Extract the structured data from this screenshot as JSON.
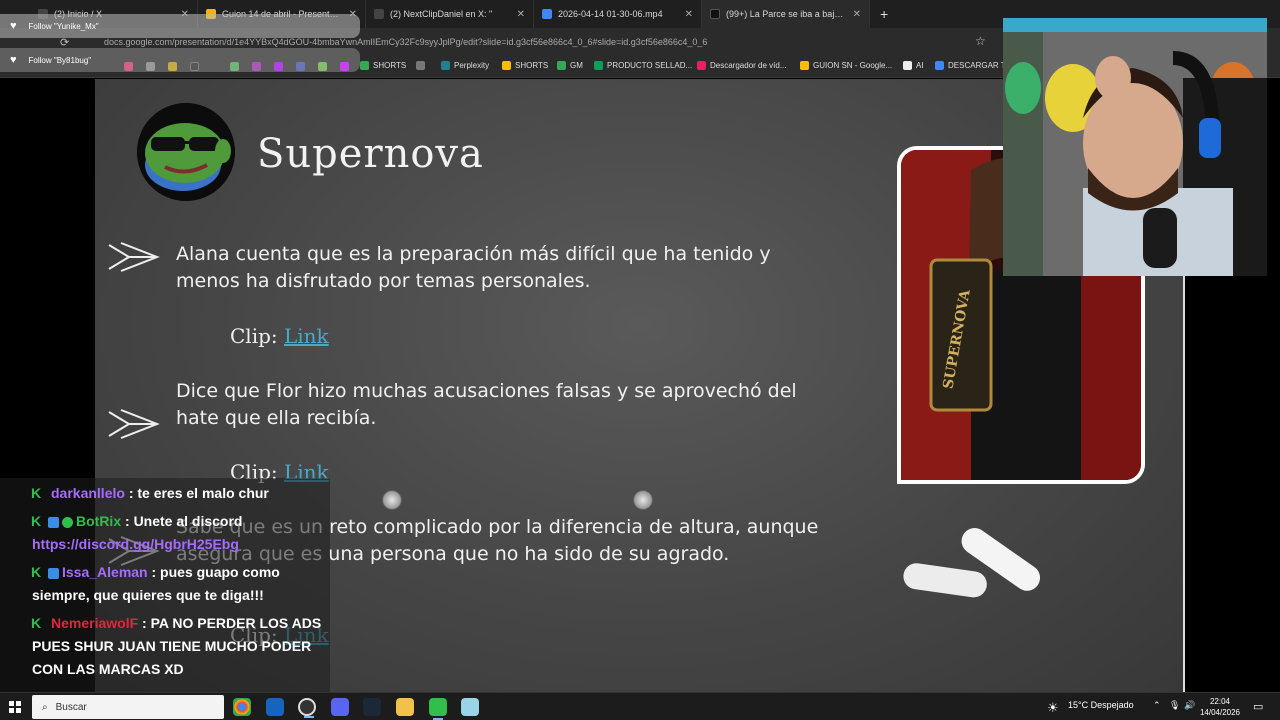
{
  "browser": {
    "tabs": [
      {
        "label": "(2) Inicio / X",
        "color": "#444444"
      },
      {
        "label": "Guion 14 de abril - Presentació",
        "color": "#f4b400"
      },
      {
        "label": "(2) NextClipDaniel en X: \"",
        "color": "#444444"
      },
      {
        "label": "2026-04-14 01-30-06.mp4",
        "color": "#4285f4"
      },
      {
        "label": "(99+) La Parce se iba a bajar de",
        "color": "#111111"
      }
    ],
    "new_tab_label": "+",
    "url": "docs.google.com/presentation/d/1e4YYBxQ4dGOU-4bmbaYwnAmlIEmCy32Fc9syyJplPg/edit?slide=id.g3cf56e866c4_0_6#slide=id.g3cf56e866c4_0_6",
    "bookmarks": [
      {
        "label": "SHORTS",
        "color": "#34a853"
      },
      {
        "label": "Perplexity",
        "color": "#20808d"
      },
      {
        "label": "SHORTS",
        "color": "#fbbc04"
      },
      {
        "label": "GM",
        "color": "#34a853"
      },
      {
        "label": "PRODUCTO SELLAD...",
        "color": "#0f9d58"
      },
      {
        "label": "Descargador de víd...",
        "color": "#e91e63"
      },
      {
        "label": "GUION SN - Google...",
        "color": "#fbbc04"
      },
      {
        "label": "AI",
        "color": "#eeeeee"
      },
      {
        "label": "DESCARGAR TV",
        "color": "#4285f4"
      }
    ]
  },
  "follows": [
    {
      "text": "Follow \"Yunike_Mx\""
    },
    {
      "text": "Follow \"By81bug\""
    }
  ],
  "slide": {
    "title": "Supernova",
    "bullets": [
      {
        "text": "Alana cuenta que es la preparación más difícil que ha tenido y menos ha disfrutado por temas personales."
      },
      {
        "text": "Dice que Flor hizo muchas acusaciones falsas y se aprovechó del hate que ella recibía."
      },
      {
        "text": "Sabe que es un reto complicado por la diferencia de altura, aunque asegura que es una persona que no ha sido de su agrado."
      }
    ],
    "clip_label": "Clip:",
    "link_label": "Link",
    "photo_text": "SUPERNOVA"
  },
  "chat": [
    {
      "user": "darkanllelo",
      "user_color": "#a76cff",
      "text": ": te eres el malo chur"
    },
    {
      "user": "BotRix",
      "user_color": "#2fbf4a",
      "text": ": Unete al discord",
      "link": "https://discord.gg/HgbrH25Ebg"
    },
    {
      "user": "Issa_Aleman",
      "user_color": "#a76cff",
      "text": ": pues guapo como siempre, que quieres que te diga!!!"
    },
    {
      "user": "NemeriawolF",
      "user_color": "#e0283c",
      "text": ": PA NO PERDER LOS ADS PUES SHUR JUAN TIENE MUCHO PODER CON LAS MARCAS XD"
    }
  ],
  "taskbar": {
    "search_label": "Buscar",
    "weather": "15°C  Despejado",
    "time": "22:04",
    "date": "14/04/2026"
  }
}
